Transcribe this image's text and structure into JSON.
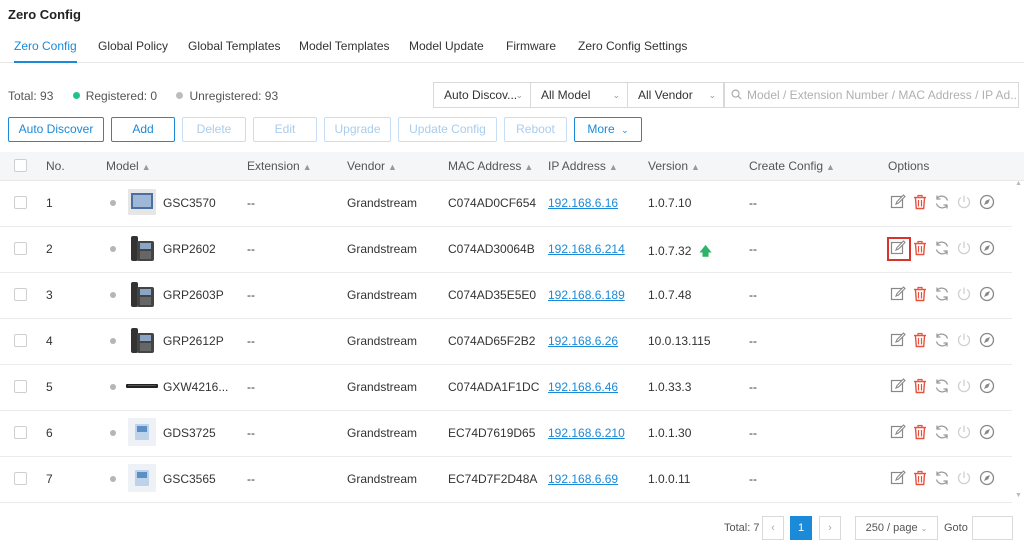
{
  "app": {
    "title": "Zero Config"
  },
  "tabs": [
    {
      "label": "Zero Config",
      "active": true
    },
    {
      "label": "Global Policy"
    },
    {
      "label": "Global Templates"
    },
    {
      "label": "Model Templates"
    },
    {
      "label": "Model Update"
    },
    {
      "label": "Firmware"
    },
    {
      "label": "Zero Config Settings"
    }
  ],
  "stats": {
    "total": "Total: 93",
    "registered": "Registered: 0",
    "unregistered": "Unregistered: 93",
    "registered_color": "#1ec28b",
    "unregistered_color": "#bdbdbd"
  },
  "filters": {
    "discover": "Auto Discov...",
    "model": "All Model",
    "vendor": "All Vendor",
    "search_placeholder": "Model / Extension Number / MAC Address / IP Ad..."
  },
  "toolbar": {
    "auto_discover": "Auto Discover",
    "add": "Add",
    "delete": "Delete",
    "edit": "Edit",
    "upgrade": "Upgrade",
    "update_config": "Update Config",
    "reboot": "Reboot",
    "more": "More"
  },
  "table": {
    "headers": {
      "no": "No.",
      "model": "Model",
      "extension": "Extension",
      "vendor": "Vendor",
      "mac": "MAC Address",
      "ip": "IP Address",
      "version": "Version",
      "create_config": "Create Config",
      "options": "Options"
    },
    "rows": [
      {
        "no": "1",
        "model": "GSC3570",
        "extension": "--",
        "vendor": "Grandstream",
        "mac": "C074AD0CF654",
        "ip": "192.168.6.16",
        "version": "1.0.7.10",
        "upgrade": false,
        "create_config": "--",
        "device_icon": "tablet-device-icon"
      },
      {
        "no": "2",
        "model": "GRP2602",
        "extension": "--",
        "vendor": "Grandstream",
        "mac": "C074AD30064B",
        "ip": "192.168.6.214",
        "version": "1.0.7.32",
        "upgrade": true,
        "create_config": "--",
        "device_icon": "desk-phone-icon",
        "edit_highlighted": true
      },
      {
        "no": "3",
        "model": "GRP2603P",
        "extension": "--",
        "vendor": "Grandstream",
        "mac": "C074AD35E5E0",
        "ip": "192.168.6.189",
        "version": "1.0.7.48",
        "upgrade": false,
        "create_config": "--",
        "device_icon": "desk-phone-icon"
      },
      {
        "no": "4",
        "model": "GRP2612P",
        "extension": "--",
        "vendor": "Grandstream",
        "mac": "C074AD65F2B2",
        "ip": "192.168.6.26",
        "version": "10.0.13.115",
        "upgrade": false,
        "create_config": "--",
        "device_icon": "desk-phone-icon"
      },
      {
        "no": "5",
        "model": "GXW4216...",
        "extension": "--",
        "vendor": "Grandstream",
        "mac": "C074ADA1F1DC",
        "ip": "192.168.6.46",
        "version": "1.0.33.3",
        "upgrade": false,
        "create_config": "--",
        "device_icon": "gateway-device-icon"
      },
      {
        "no": "6",
        "model": "GDS3725",
        "extension": "--",
        "vendor": "Grandstream",
        "mac": "EC74D7619D65",
        "ip": "192.168.6.210",
        "version": "1.0.1.30",
        "upgrade": false,
        "create_config": "--",
        "device_icon": "door-station-icon"
      },
      {
        "no": "7",
        "model": "GSC3565",
        "extension": "--",
        "vendor": "Grandstream",
        "mac": "EC74D7F2D48A",
        "ip": "192.168.6.69",
        "version": "1.0.0.11",
        "upgrade": false,
        "create_config": "--",
        "device_icon": "door-station-icon"
      }
    ]
  },
  "pagination": {
    "total": "Total: 7",
    "current_page": "1",
    "page_size": "250 / page",
    "goto": "Goto"
  },
  "colors": {
    "accent": "#1b8ad8",
    "delete_icon": "#e8513d",
    "highlight_box": "#d9342b",
    "upgrade_arrow": "#2eb36a"
  }
}
